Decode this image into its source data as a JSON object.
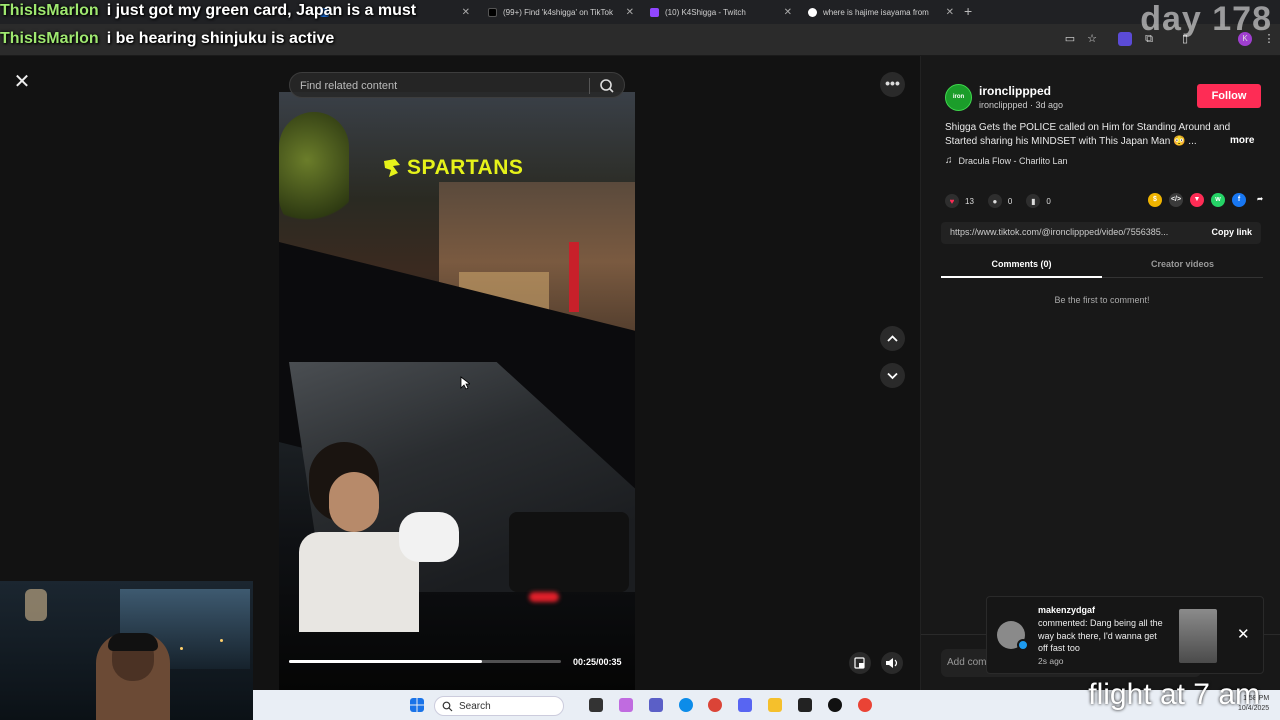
{
  "browser": {
    "tabs": [
      {
        "label": "",
        "color": "#1a73e8"
      },
      {
        "label": "(99+) Find 'k4shigga' on TikTok",
        "color": "#000000"
      },
      {
        "label": "(10) K4Shigga - Twitch",
        "color": "#9146ff"
      },
      {
        "label": "where is hajime isayama from",
        "color": "#ffffff"
      }
    ]
  },
  "overlay": {
    "chat": [
      {
        "user": "ThisIsMarlon",
        "message": "i just got my green card, Japan is a must"
      },
      {
        "user": "ThisIsMarlon",
        "message": "i be hearing shinjuku is active"
      }
    ],
    "day_counter": "day 178",
    "caption": "flight at 7 am"
  },
  "search": {
    "placeholder": "Find related content"
  },
  "video": {
    "brand": "SPARTANS",
    "progress": 0.71,
    "time": "00:25/00:35"
  },
  "post": {
    "avatar_text": "iron",
    "username": "ironclippped",
    "meta": "ironclippped · 3d ago",
    "follow_label": "Follow",
    "caption": "Shigga Gets the POLICE called on Him for Standing Around and Started sharing his MINDSET with This Japan Man 😳 ...",
    "more_label": "more",
    "music": "Dracula Flow - Charlito Lan",
    "likes": "13",
    "comments": "0",
    "saves": "0",
    "link": "https://www.tiktok.com/@ironclippped/video/7556385...",
    "copy_label": "Copy link",
    "tabs": {
      "comments": "Comments (0)",
      "creator": "Creator videos"
    },
    "empty_text": "Be the first to comment!",
    "add_comment": "Add comm"
  },
  "notification": {
    "user": "makenzydgaf",
    "message": "commented: Dang being all the way back there, I'd wanna get off fast too",
    "time": "2s ago"
  },
  "taskbar": {
    "search_label": "Search",
    "time": "1:58 PM",
    "date": "10/4/2025"
  },
  "colors": {
    "accent": "#fe2c55",
    "brand": "#e6f21a",
    "chat_user": "#9fe870"
  }
}
